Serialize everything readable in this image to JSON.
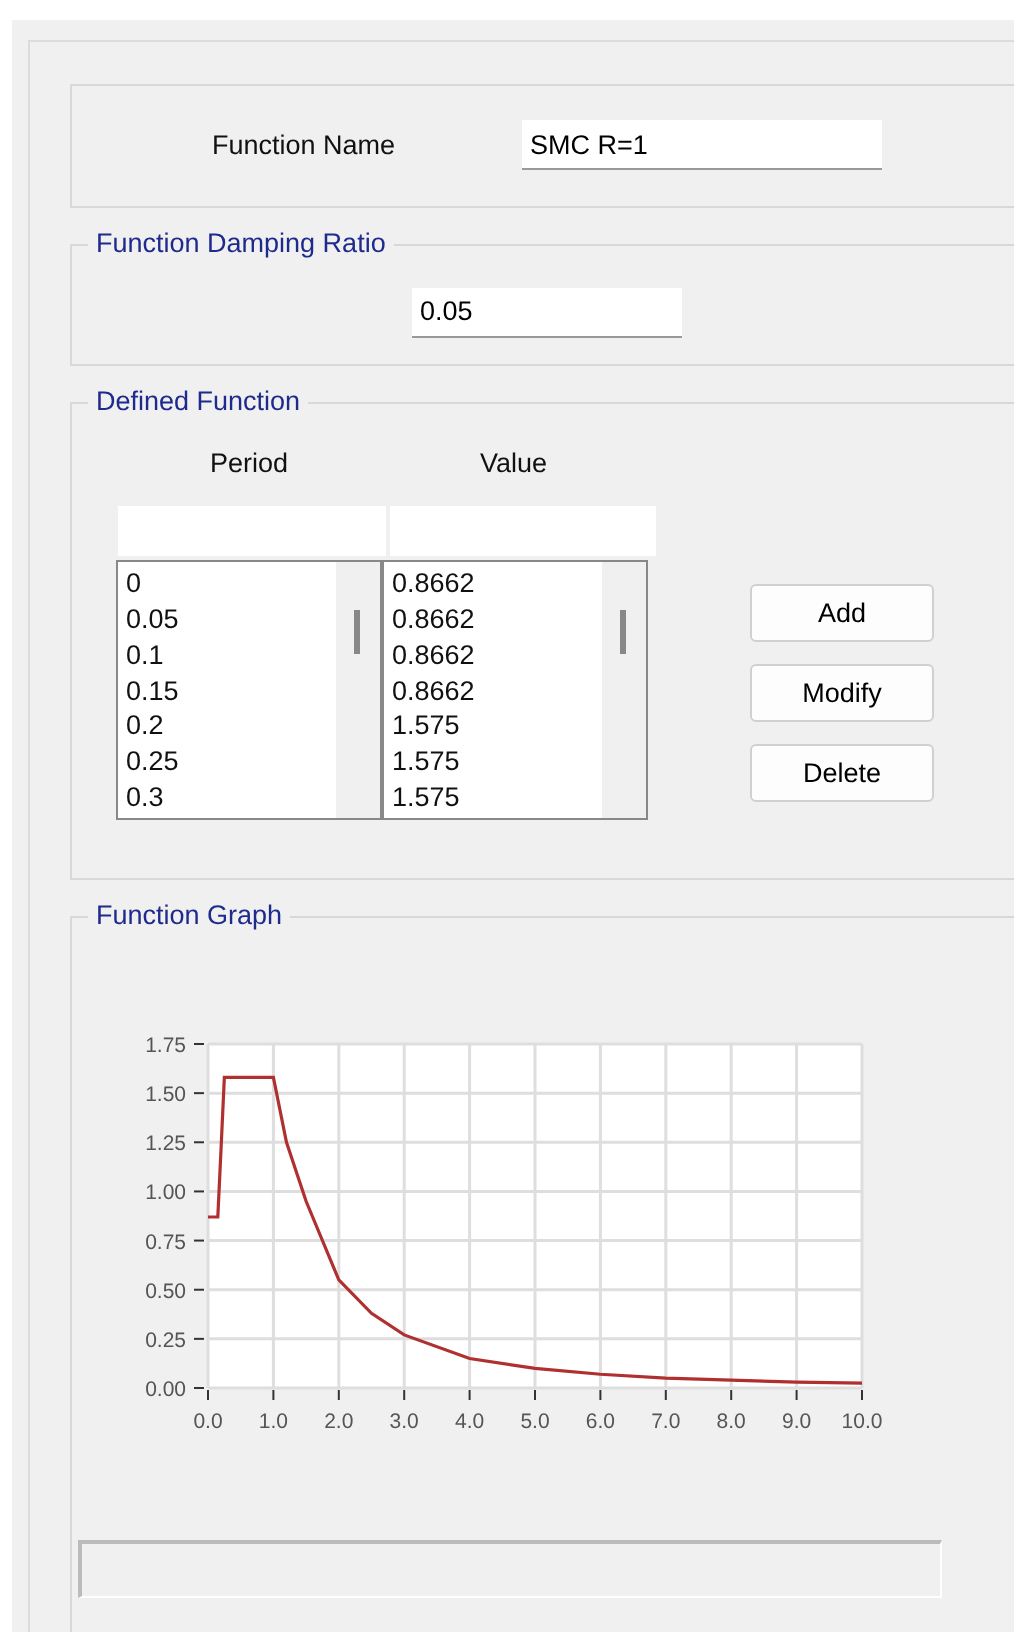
{
  "function_name": {
    "label": "Function Name",
    "value": "SMC R=1"
  },
  "damping": {
    "title": "Function Damping Ratio",
    "value": "0.05"
  },
  "defined_function": {
    "title": "Defined Function",
    "columns": [
      "Period",
      "Value"
    ],
    "periods": [
      "0",
      "0.05",
      "0.1",
      "0.15",
      "0.2",
      "0.25",
      "0.3"
    ],
    "values": [
      "0.8662",
      "0.8662",
      "0.8662",
      "0.8662",
      "1.575",
      "1.575",
      "1.575"
    ],
    "buttons": [
      "Add",
      "Modify",
      "Delete"
    ]
  },
  "graph": {
    "title": "Function Graph",
    "chart_data": {
      "type": "line",
      "x": [
        0,
        0.15,
        0.2,
        0.25,
        1,
        1.2,
        1.5,
        2,
        2.5,
        3,
        4,
        5,
        6,
        7,
        8,
        9,
        10
      ],
      "grid": true,
      "series": [
        {
          "color": "#b03030",
          "values": [
            0.87,
            0.87,
            1.22,
            1.58,
            1.58,
            1.25,
            0.95,
            0.55,
            0.38,
            0.27,
            0.15,
            0.1,
            0.07,
            0.05,
            0.04,
            0.03,
            0.025
          ]
        }
      ],
      "xlim": [
        0,
        10
      ],
      "ylim": [
        0,
        1.75
      ],
      "xticks": [
        {
          "value": 0,
          "label": "0.0"
        },
        {
          "value": 1,
          "label": "1.0"
        },
        {
          "value": 2,
          "label": "2.0"
        },
        {
          "value": 3,
          "label": "3.0"
        },
        {
          "value": 4,
          "label": "4.0"
        },
        {
          "value": 5,
          "label": "5.0"
        },
        {
          "value": 6,
          "label": "6.0"
        },
        {
          "value": 7,
          "label": "7.0"
        },
        {
          "value": 8,
          "label": "8.0"
        },
        {
          "value": 9,
          "label": "9.0"
        },
        {
          "value": 10,
          "label": "10.0"
        }
      ],
      "yticks": [
        {
          "value": 0,
          "label": "0.00"
        },
        {
          "value": 0.25,
          "label": "0.25"
        },
        {
          "value": 0.5,
          "label": "0.50"
        },
        {
          "value": 0.75,
          "label": "0.75"
        },
        {
          "value": 1,
          "label": "1.00"
        },
        {
          "value": 1.25,
          "label": "1.25"
        },
        {
          "value": 1.5,
          "label": "1.50"
        },
        {
          "value": 1.75,
          "label": "1.75"
        }
      ]
    }
  }
}
